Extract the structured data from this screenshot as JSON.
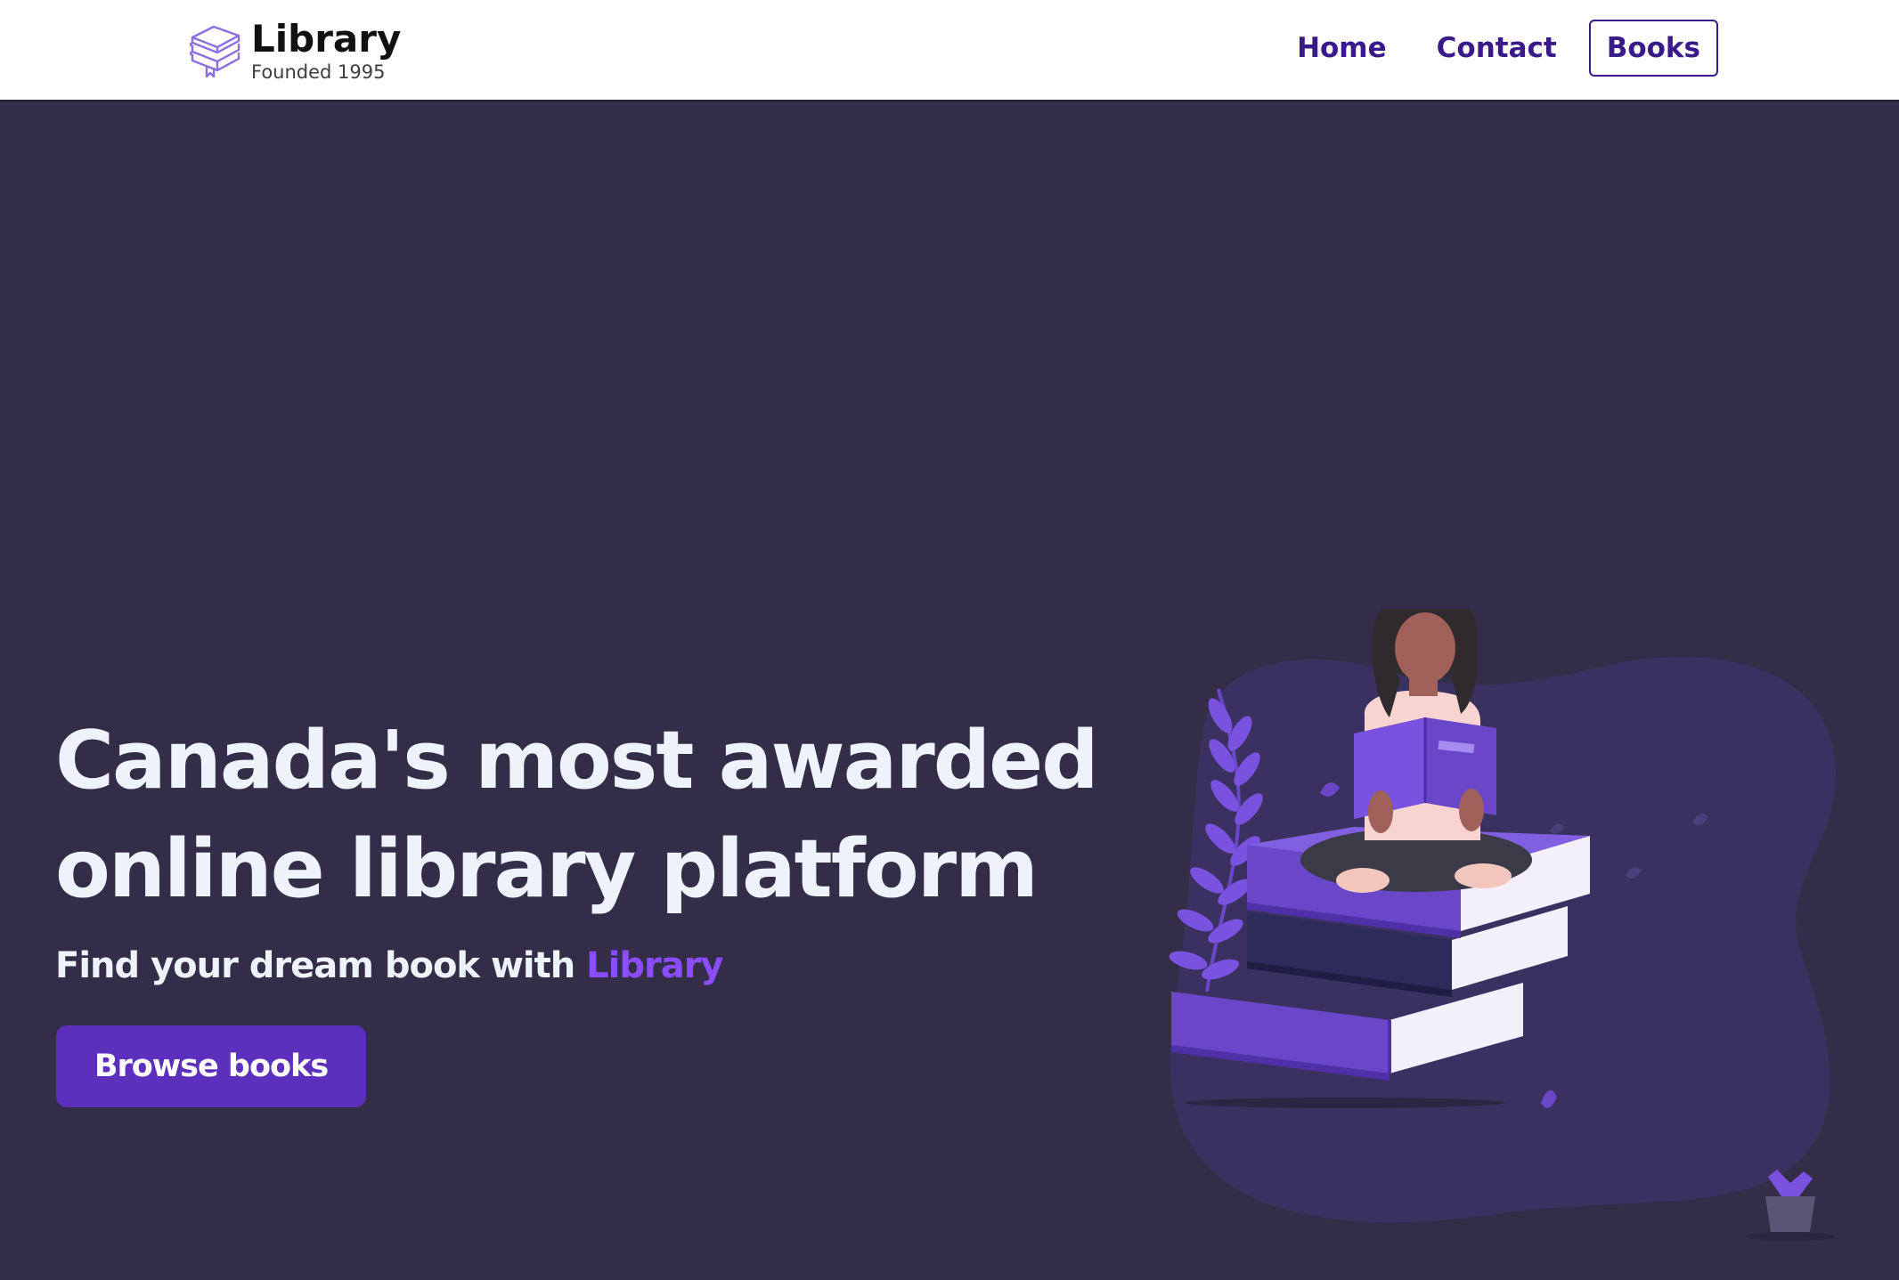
{
  "brand": {
    "name": "Library",
    "tagline": "Founded 1995",
    "icon": "stacked-books-icon",
    "accent_color": "#8a4dff",
    "nav_color": "#3a1a8a"
  },
  "nav": {
    "links": [
      {
        "label": "Home",
        "active": false
      },
      {
        "label": "Contact",
        "active": false
      },
      {
        "label": "Books",
        "active": true
      }
    ]
  },
  "hero": {
    "title_line1": "Canada's most awarded",
    "title_line2": "online library platform",
    "subtitle_prefix": "Find your dream book with ",
    "subtitle_accent": "Library",
    "cta_label": "Browse books",
    "background_color": "#332d48",
    "button_color": "#5c2fbd",
    "illustration": "woman-reading-on-book-stack-illustration"
  }
}
